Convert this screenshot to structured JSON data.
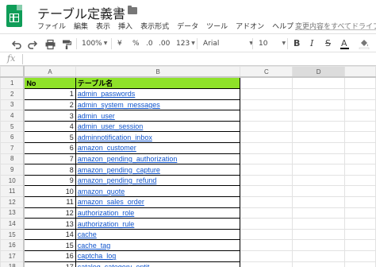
{
  "app": {
    "title": "テーブル定義書",
    "star_icon": "star-outline-icon",
    "folder_icon": "folder-icon",
    "brand_color": "#0f9d58"
  },
  "menu": {
    "items": [
      "ファイル",
      "編集",
      "表示",
      "挿入",
      "表示形式",
      "データ",
      "ツール",
      "アドオン",
      "ヘルプ"
    ],
    "save_status": "変更内容をすべてドライブ"
  },
  "toolbar": {
    "zoom": "100%",
    "currency": "¥",
    "percent": "%",
    "decimal_decrease": ".0",
    "decimal_increase": ".00",
    "more_formats": "123",
    "font": "Arial",
    "font_size": "10",
    "bold": "B",
    "italic": "I",
    "strikethrough": "S",
    "text_color": "A"
  },
  "formula_bar": {
    "fx_label": "fx",
    "value": ""
  },
  "sheet": {
    "columns": [
      "A",
      "B",
      "C",
      "D"
    ],
    "selected_column": "D",
    "header_fill": "#8fe229",
    "header_row": {
      "row": "1",
      "a": "No",
      "b": "テーブル名"
    },
    "rows": [
      {
        "row": "2",
        "no": "1",
        "name": "admin_passwords"
      },
      {
        "row": "3",
        "no": "2",
        "name": "admin_system_messages"
      },
      {
        "row": "4",
        "no": "3",
        "name": "admin_user"
      },
      {
        "row": "5",
        "no": "4",
        "name": "admin_user_session"
      },
      {
        "row": "6",
        "no": "5",
        "name": "adminnotification_inbox"
      },
      {
        "row": "7",
        "no": "6",
        "name": "amazon_customer"
      },
      {
        "row": "8",
        "no": "7",
        "name": "amazon_pending_authorization"
      },
      {
        "row": "9",
        "no": "8",
        "name": "amazon_pending_capture"
      },
      {
        "row": "10",
        "no": "9",
        "name": "amazon_pending_refund"
      },
      {
        "row": "11",
        "no": "10",
        "name": "amazon_quote"
      },
      {
        "row": "12",
        "no": "11",
        "name": "amazon_sales_order"
      },
      {
        "row": "13",
        "no": "12",
        "name": "authorization_role"
      },
      {
        "row": "14",
        "no": "13",
        "name": "authorization_rule"
      },
      {
        "row": "15",
        "no": "14",
        "name": "cache"
      },
      {
        "row": "16",
        "no": "15",
        "name": "cache_tag"
      },
      {
        "row": "17",
        "no": "16",
        "name": "captcha_log"
      },
      {
        "row": "18",
        "no": "17",
        "name": "catalog_category_entit"
      }
    ]
  }
}
